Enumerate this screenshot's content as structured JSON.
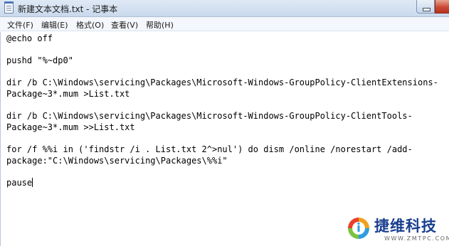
{
  "window": {
    "title": "新建文本文档.txt - 记事本"
  },
  "menu": {
    "items": [
      {
        "label": "文件(F)"
      },
      {
        "label": "编辑(E)"
      },
      {
        "label": "格式(O)"
      },
      {
        "label": "查看(V)"
      },
      {
        "label": "帮助(H)"
      }
    ]
  },
  "editor": {
    "lines": [
      "@echo off",
      "",
      "pushd \"%~dp0\"",
      "",
      "dir /b C:\\Windows\\servicing\\Packages\\Microsoft-Windows-GroupPolicy-ClientExtensions-",
      "Package~3*.mum >List.txt",
      "",
      "dir /b C:\\Windows\\servicing\\Packages\\Microsoft-Windows-GroupPolicy-ClientTools-",
      "Package~3*.mum >>List.txt",
      "",
      "for /f %%i in ('findstr /i . List.txt 2^>nul') do dism /online /norestart /add-",
      "package:\"C:\\Windows\\servicing\\Packages\\%%i\"",
      "",
      "pause"
    ]
  },
  "watermark": {
    "name": "捷维科技",
    "url": "WWW.ZMTPC.COM",
    "icon": "logo-icon"
  }
}
